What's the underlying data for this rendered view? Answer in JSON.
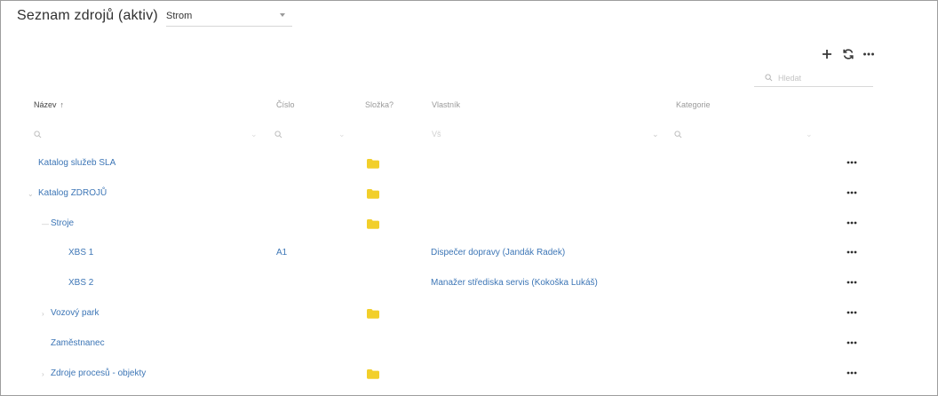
{
  "page": {
    "title": "Seznam zdrojů (aktiv)"
  },
  "view_select": {
    "value": "Strom"
  },
  "toolbar": {
    "add_icon": "plus-icon",
    "refresh_icon": "refresh-icon",
    "more_icon": "more-horizontal-icon"
  },
  "search": {
    "placeholder": "Hledat"
  },
  "columns": {
    "name": "Název",
    "sort_indicator": "↑",
    "number": "Číslo",
    "folder": "Složka?",
    "owner": "Vlastník",
    "category": "Kategorie"
  },
  "filters": {
    "owner_placeholder": "Vš"
  },
  "colors": {
    "link": "#3d76b6",
    "folder": "#f2cf2a"
  },
  "rows": [
    {
      "name": "Katalog služeb SLA",
      "number": "",
      "folder": true,
      "owner": "",
      "toggle": ""
    },
    {
      "name": "Katalog ZDROJŮ",
      "number": "",
      "folder": true,
      "owner": "",
      "toggle": "⌄"
    },
    {
      "name": "Stroje",
      "number": "",
      "folder": true,
      "owner": "",
      "toggle": "—"
    },
    {
      "name": "XBS 1",
      "number": "A1",
      "folder": false,
      "owner": "Dispečer dopravy (Jandák Radek)",
      "toggle": ""
    },
    {
      "name": "XBS 2",
      "number": "",
      "folder": false,
      "owner": "Manažer střediska servis (Kokoška Lukáš)",
      "toggle": ""
    },
    {
      "name": "Vozový park",
      "number": "",
      "folder": true,
      "owner": "",
      "toggle": "›"
    },
    {
      "name": "Zaměstnanec",
      "number": "",
      "folder": false,
      "owner": "",
      "toggle": ""
    },
    {
      "name": "Zdroje procesů - objekty",
      "number": "",
      "folder": true,
      "owner": "",
      "toggle": "›"
    }
  ]
}
